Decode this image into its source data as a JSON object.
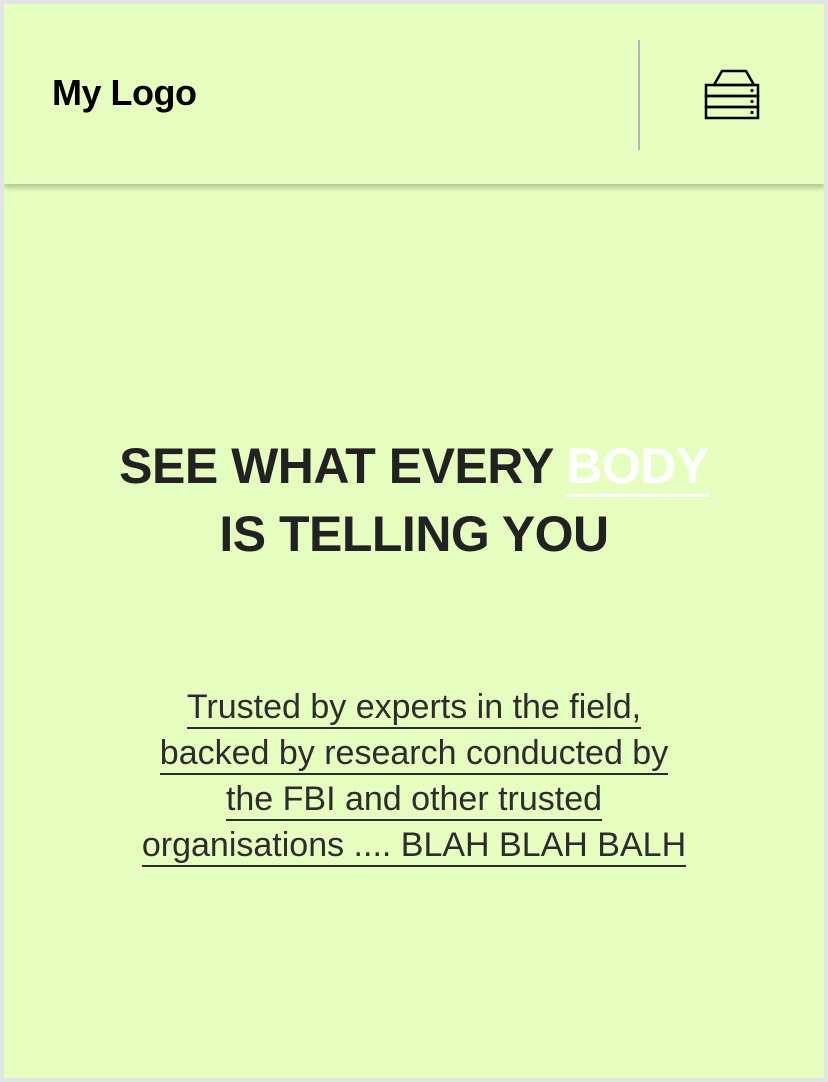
{
  "header": {
    "logo_text": "My Logo",
    "menu_icon": "server-stack-icon"
  },
  "hero": {
    "headline_part1": "SEE WHAT EVERY ",
    "headline_highlight": "BODY",
    "headline_part2": "IS TELLING YOU",
    "tagline_lines": [
      "Trusted by experts in the field,",
      "backed by research conducted by",
      "the FBI and other trusted",
      "organisations .... BLAH BLAH BALH"
    ]
  },
  "colors": {
    "background": "#e6fec0",
    "headline_text": "#222222",
    "highlight": "#ffffff",
    "divider": "#b3b3b3"
  }
}
